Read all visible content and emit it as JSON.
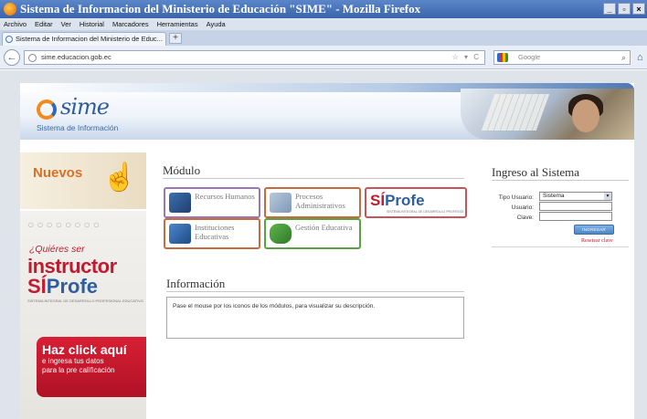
{
  "window": {
    "title": "Sistema de Informacion del Ministerio de Educación \"SIME\" - Mozilla Firefox",
    "controls": [
      "_",
      "▫",
      "×"
    ]
  },
  "menu": [
    "Archivo",
    "Editar",
    "Ver",
    "Historial",
    "Marcadores",
    "Herramientas",
    "Ayuda"
  ],
  "tab": {
    "label": "Sistema de Informacion del Ministerio de Educ...",
    "new_tab": "+"
  },
  "nav": {
    "back": "←",
    "url": "sime.educacion.gob.ec",
    "url_controls": "☆ ▾ C",
    "search_placeholder": "Google"
  },
  "header": {
    "logo_text": "sime",
    "logo_subtitle": "Sistema de Información"
  },
  "left": {
    "nuevos": "Nuevos",
    "promo_question": "¿Quiéres ser",
    "promo_instructor": "instructor",
    "promo_si": "SÍ",
    "promo_profe": "Profe",
    "promo_caption": "SISTEMA INTEGRAL DE DESARROLLO PROFESIONAL EDUCATIVO",
    "cta_line1": "Haz click aquí",
    "cta_line2": "e ingresa tus datos",
    "cta_line3": "para la pre calificación"
  },
  "modulo": {
    "title": "Módulo",
    "items": [
      {
        "label": "Recursos Humanos"
      },
      {
        "label": "Procesos Administrativos"
      },
      {
        "label_si": "SÍ",
        "label_profe": "Profe",
        "caption": "SISTEMA INTEGRAL DE DESARROLLO PROFESIONAL EDUCATIVO"
      },
      {
        "label": "Instituciones Educativas"
      },
      {
        "label": "Gestión Educativa"
      }
    ]
  },
  "info": {
    "title": "Información",
    "text": "Pase el mouse por los iconos de los módulos, para visualizar su descripción."
  },
  "login": {
    "title": "Ingreso al Sistema",
    "tipo_label": "Tipo Usuario:",
    "tipo_value": "Sistema",
    "usuario_label": "Usuario:",
    "clave_label": "Clave:",
    "ingresar": "INGRESAR",
    "reset": "Resetear clave"
  },
  "colors": {
    "brand_red": "#c01b2f",
    "brand_blue": "#2f5e9e",
    "accent_orange": "#f28a1e"
  }
}
